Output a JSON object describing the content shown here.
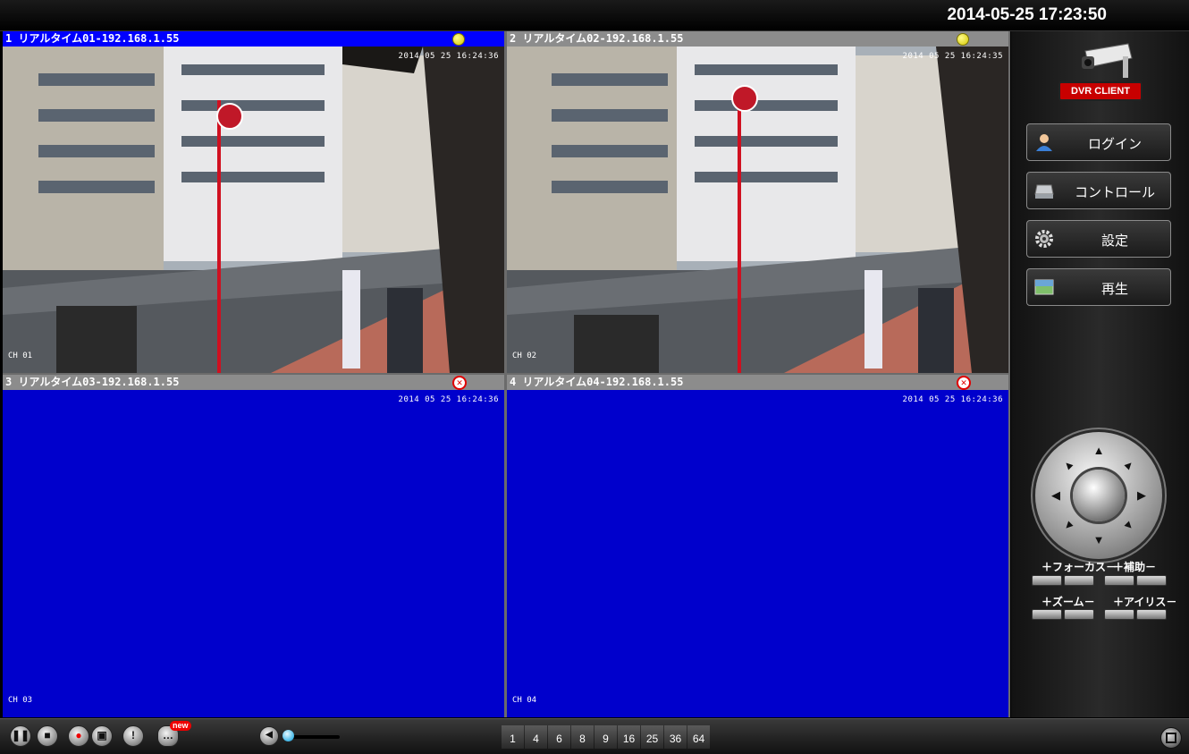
{
  "header": {
    "datetime": "2014-05-25 17:23:50"
  },
  "channels": [
    {
      "title": "1 リアルタイム01-192.168.1.55",
      "status": "connected",
      "timestamp": "2014 05 25 16:24:36",
      "label": "CH 01"
    },
    {
      "title": "2 リアルタイム02-192.168.1.55",
      "status": "connected",
      "timestamp": "2014 05 25 16:24:35",
      "label": "CH 02"
    },
    {
      "title": "3 リアルタイム03-192.168.1.55",
      "status": "error",
      "timestamp": "2014 05 25 16:24:36",
      "label": "CH 03"
    },
    {
      "title": "4 リアルタイム04-192.168.1.55",
      "status": "error",
      "timestamp": "2014 05 25 16:24:36",
      "label": "CH 04"
    }
  ],
  "sidebar": {
    "logo_text": "DVR CLIENT",
    "buttons": [
      {
        "label": "ログイン",
        "icon": "user-icon"
      },
      {
        "label": "コントロール",
        "icon": "disk-icon"
      },
      {
        "label": "設定",
        "icon": "gear-icon"
      },
      {
        "label": "再生",
        "icon": "playback-icon"
      }
    ],
    "ptz": {
      "focus_label": "＋フォーカス－",
      "aux_label": "＋補助－",
      "zoom_label": "＋ズーム－",
      "iris_label": "＋アイリス－"
    }
  },
  "toolbar": {
    "new_badge": "new",
    "split_options": [
      "1",
      "4",
      "6",
      "8",
      "9",
      "16",
      "25",
      "36",
      "64"
    ]
  },
  "colors": {
    "no_signal": "#0000cc",
    "active_header": "#0000ff",
    "inactive_header": "#8c8c8c"
  }
}
